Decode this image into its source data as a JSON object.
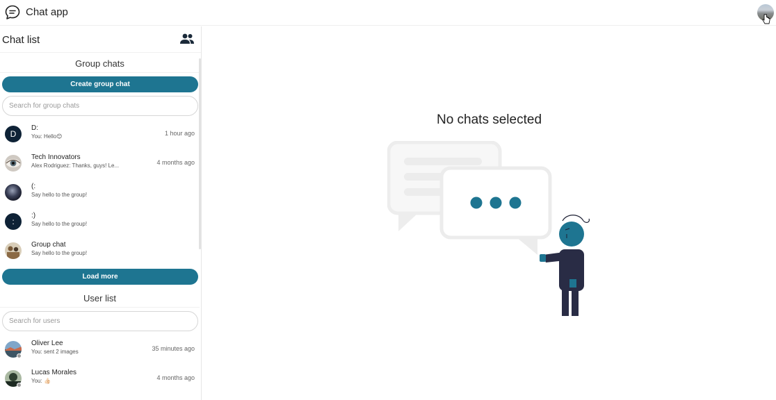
{
  "app": {
    "title": "Chat app",
    "icons": {
      "logo": "chat-bubble-icon",
      "avatar": "user-avatar",
      "people": "people-icon"
    }
  },
  "sidebar": {
    "title": "Chat list",
    "group_section": {
      "label": "Group chats",
      "create_button": "Create group chat",
      "search_placeholder": "Search for group chats",
      "chats": [
        {
          "name": "D:",
          "message": "You: Hello😊",
          "time": "1 hour ago",
          "avatar": "D"
        },
        {
          "name": "Tech Innovators",
          "message": "Alex Rodriguez: Thanks, guys! Le...",
          "time": "4 months ago"
        },
        {
          "name": "(:",
          "message": "Say hello to the group!",
          "time": ""
        },
        {
          "name": ":)",
          "message": "Say hello to the group!",
          "time": "",
          "avatar": ":"
        },
        {
          "name": "Group chat",
          "message": "Say hello to the group!",
          "time": ""
        }
      ],
      "load_more": "Load more"
    },
    "user_section": {
      "label": "User list",
      "search_placeholder": "Search for users",
      "users": [
        {
          "name": "Oliver Lee",
          "message": "You: sent 2 images",
          "time": "35 minutes ago"
        },
        {
          "name": "Lucas Morales",
          "message": "You: 👍🏻",
          "time": "4 months ago"
        }
      ]
    }
  },
  "main": {
    "empty_title": "No chats selected"
  },
  "colors": {
    "accent": "#1e7591",
    "dark": "#0e2236",
    "illustration_gray": "#ececec"
  }
}
